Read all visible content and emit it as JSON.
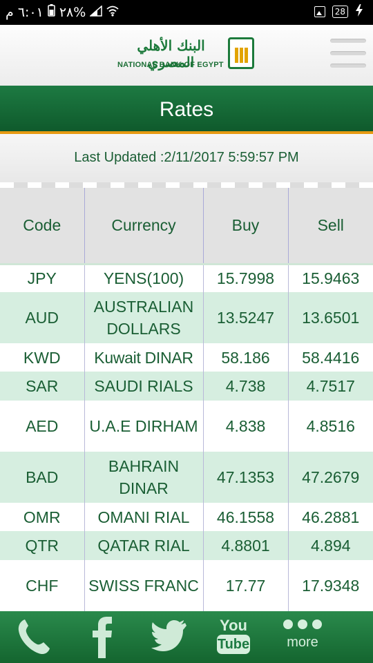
{
  "status_bar": {
    "time": "٦:٠١ م",
    "battery": "٢٨%",
    "notification_count": "28"
  },
  "header": {
    "logo_arabic": "البنك الأهلي المصري",
    "logo_english": "NATIONAL BANK OF EGYPT",
    "menu_icon": "hamburger-menu-icon"
  },
  "page": {
    "title": "Rates",
    "last_updated": "Last Updated :2/11/2017 5:59:57 PM"
  },
  "table": {
    "columns": [
      "Code",
      "Currency",
      "Buy",
      "Sell"
    ],
    "rows": [
      {
        "code": "JPY",
        "currency": "YENS(100)",
        "buy": "15.7998",
        "sell": "15.9463"
      },
      {
        "code": "AUD",
        "currency": "AUSTRALIAN DOLLARS",
        "buy": "13.5247",
        "sell": "13.6501"
      },
      {
        "code": "KWD",
        "currency": "Kuwait DINAR",
        "buy": "58.186",
        "sell": "58.4416"
      },
      {
        "code": "SAR",
        "currency": "SAUDI RIALS",
        "buy": "4.738",
        "sell": "4.7517"
      },
      {
        "code": "AED",
        "currency": "U.A.E DIRHAM",
        "buy": "4.838",
        "sell": "4.8516"
      },
      {
        "code": "BAD",
        "currency": "BAHRAIN DINAR",
        "buy": "47.1353",
        "sell": "47.2679"
      },
      {
        "code": "OMR",
        "currency": "OMANI RIAL",
        "buy": "46.1558",
        "sell": "46.2881"
      },
      {
        "code": "QTR",
        "currency": "QATAR RIAL",
        "buy": "4.8801",
        "sell": "4.894"
      },
      {
        "code": "CHF",
        "currency": "SWISS FRANC",
        "buy": "17.77",
        "sell": "17.9348"
      }
    ]
  },
  "bottom_nav": {
    "phone_icon": "phone-icon",
    "facebook_icon": "facebook-icon",
    "twitter_icon": "twitter-icon",
    "youtube_top": "You",
    "youtube_bottom": "Tube",
    "more_label": "more"
  },
  "colors": {
    "brand_green": "#1d7a42",
    "accent_orange": "#e69a12",
    "row_alt": "#d6eee0"
  }
}
